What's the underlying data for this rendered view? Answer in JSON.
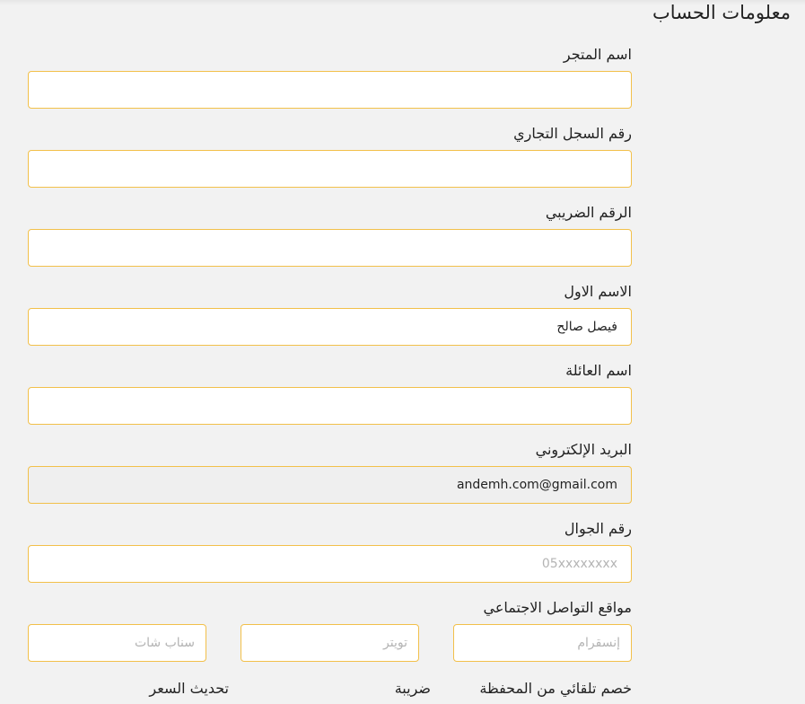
{
  "page": {
    "title": "معلومات الحساب"
  },
  "fields": {
    "store_name": {
      "label": "اسم المتجر",
      "value": ""
    },
    "commercial_register": {
      "label": "رقم السجل التجاري",
      "value": ""
    },
    "tax_number": {
      "label": "الرقم الضريبي",
      "value": ""
    },
    "first_name": {
      "label": "الاسم الاول",
      "value": "فيصل صالح"
    },
    "family_name": {
      "label": "اسم العائلة",
      "value": ""
    },
    "email": {
      "label": "البريد الإلكتروني",
      "value": "andemh.com@gmail.com"
    },
    "mobile": {
      "label": "رقم الجوال",
      "value": "",
      "placeholder": "05xxxxxxxx"
    }
  },
  "social": {
    "label": "مواقع التواصل الاجتماعي",
    "instagram_placeholder": "إنسقرام",
    "twitter_placeholder": "تويتر",
    "snapchat_placeholder": "سناب شات"
  },
  "options": {
    "auto_discount": "خصم تلقائي من المحفظة",
    "tax": "ضريبة",
    "price_update": "تحديث السعر"
  },
  "colors": {
    "input_border": "#f2c04a",
    "background": "#f2f2f2",
    "readonly_background": "#efefef"
  }
}
